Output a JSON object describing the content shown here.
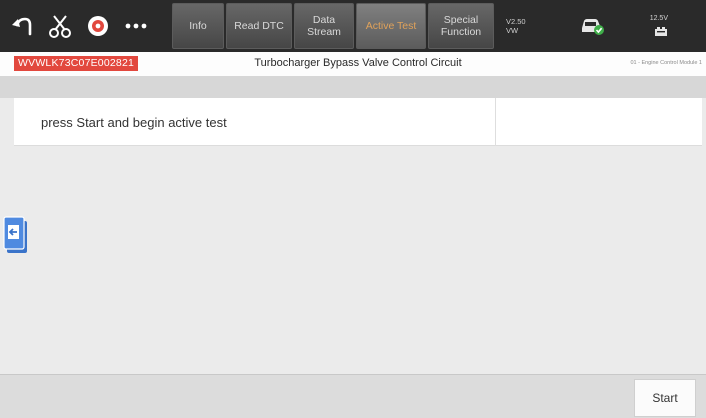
{
  "toolbar": {
    "icons": [
      "back-icon",
      "scissors-icon",
      "record-icon",
      "more-icon"
    ],
    "tabs": {
      "info": "Info",
      "read_dtc": "Read DTC",
      "data_stream_line1": "Data",
      "data_stream_line2": "Stream",
      "active_test": "Active Test",
      "special_line1": "Special",
      "special_line2": "Function"
    },
    "version_line1": "V2.50",
    "version_line2": "VW",
    "right_top": "12.5V",
    "accent_color": "#e0a25a"
  },
  "info": {
    "vin": "WVWLK73C07E002821",
    "title": "Turbocharger Bypass Valve Control Circuit",
    "module": "01 - Engine Control Module 1"
  },
  "message": "press Start and begin active test",
  "bottom": {
    "start_label": "Start"
  },
  "colors": {
    "vin_badge": "#e2483e",
    "toolbar_bg": "#2a2a2a",
    "side_handle": "#3a73c9"
  }
}
